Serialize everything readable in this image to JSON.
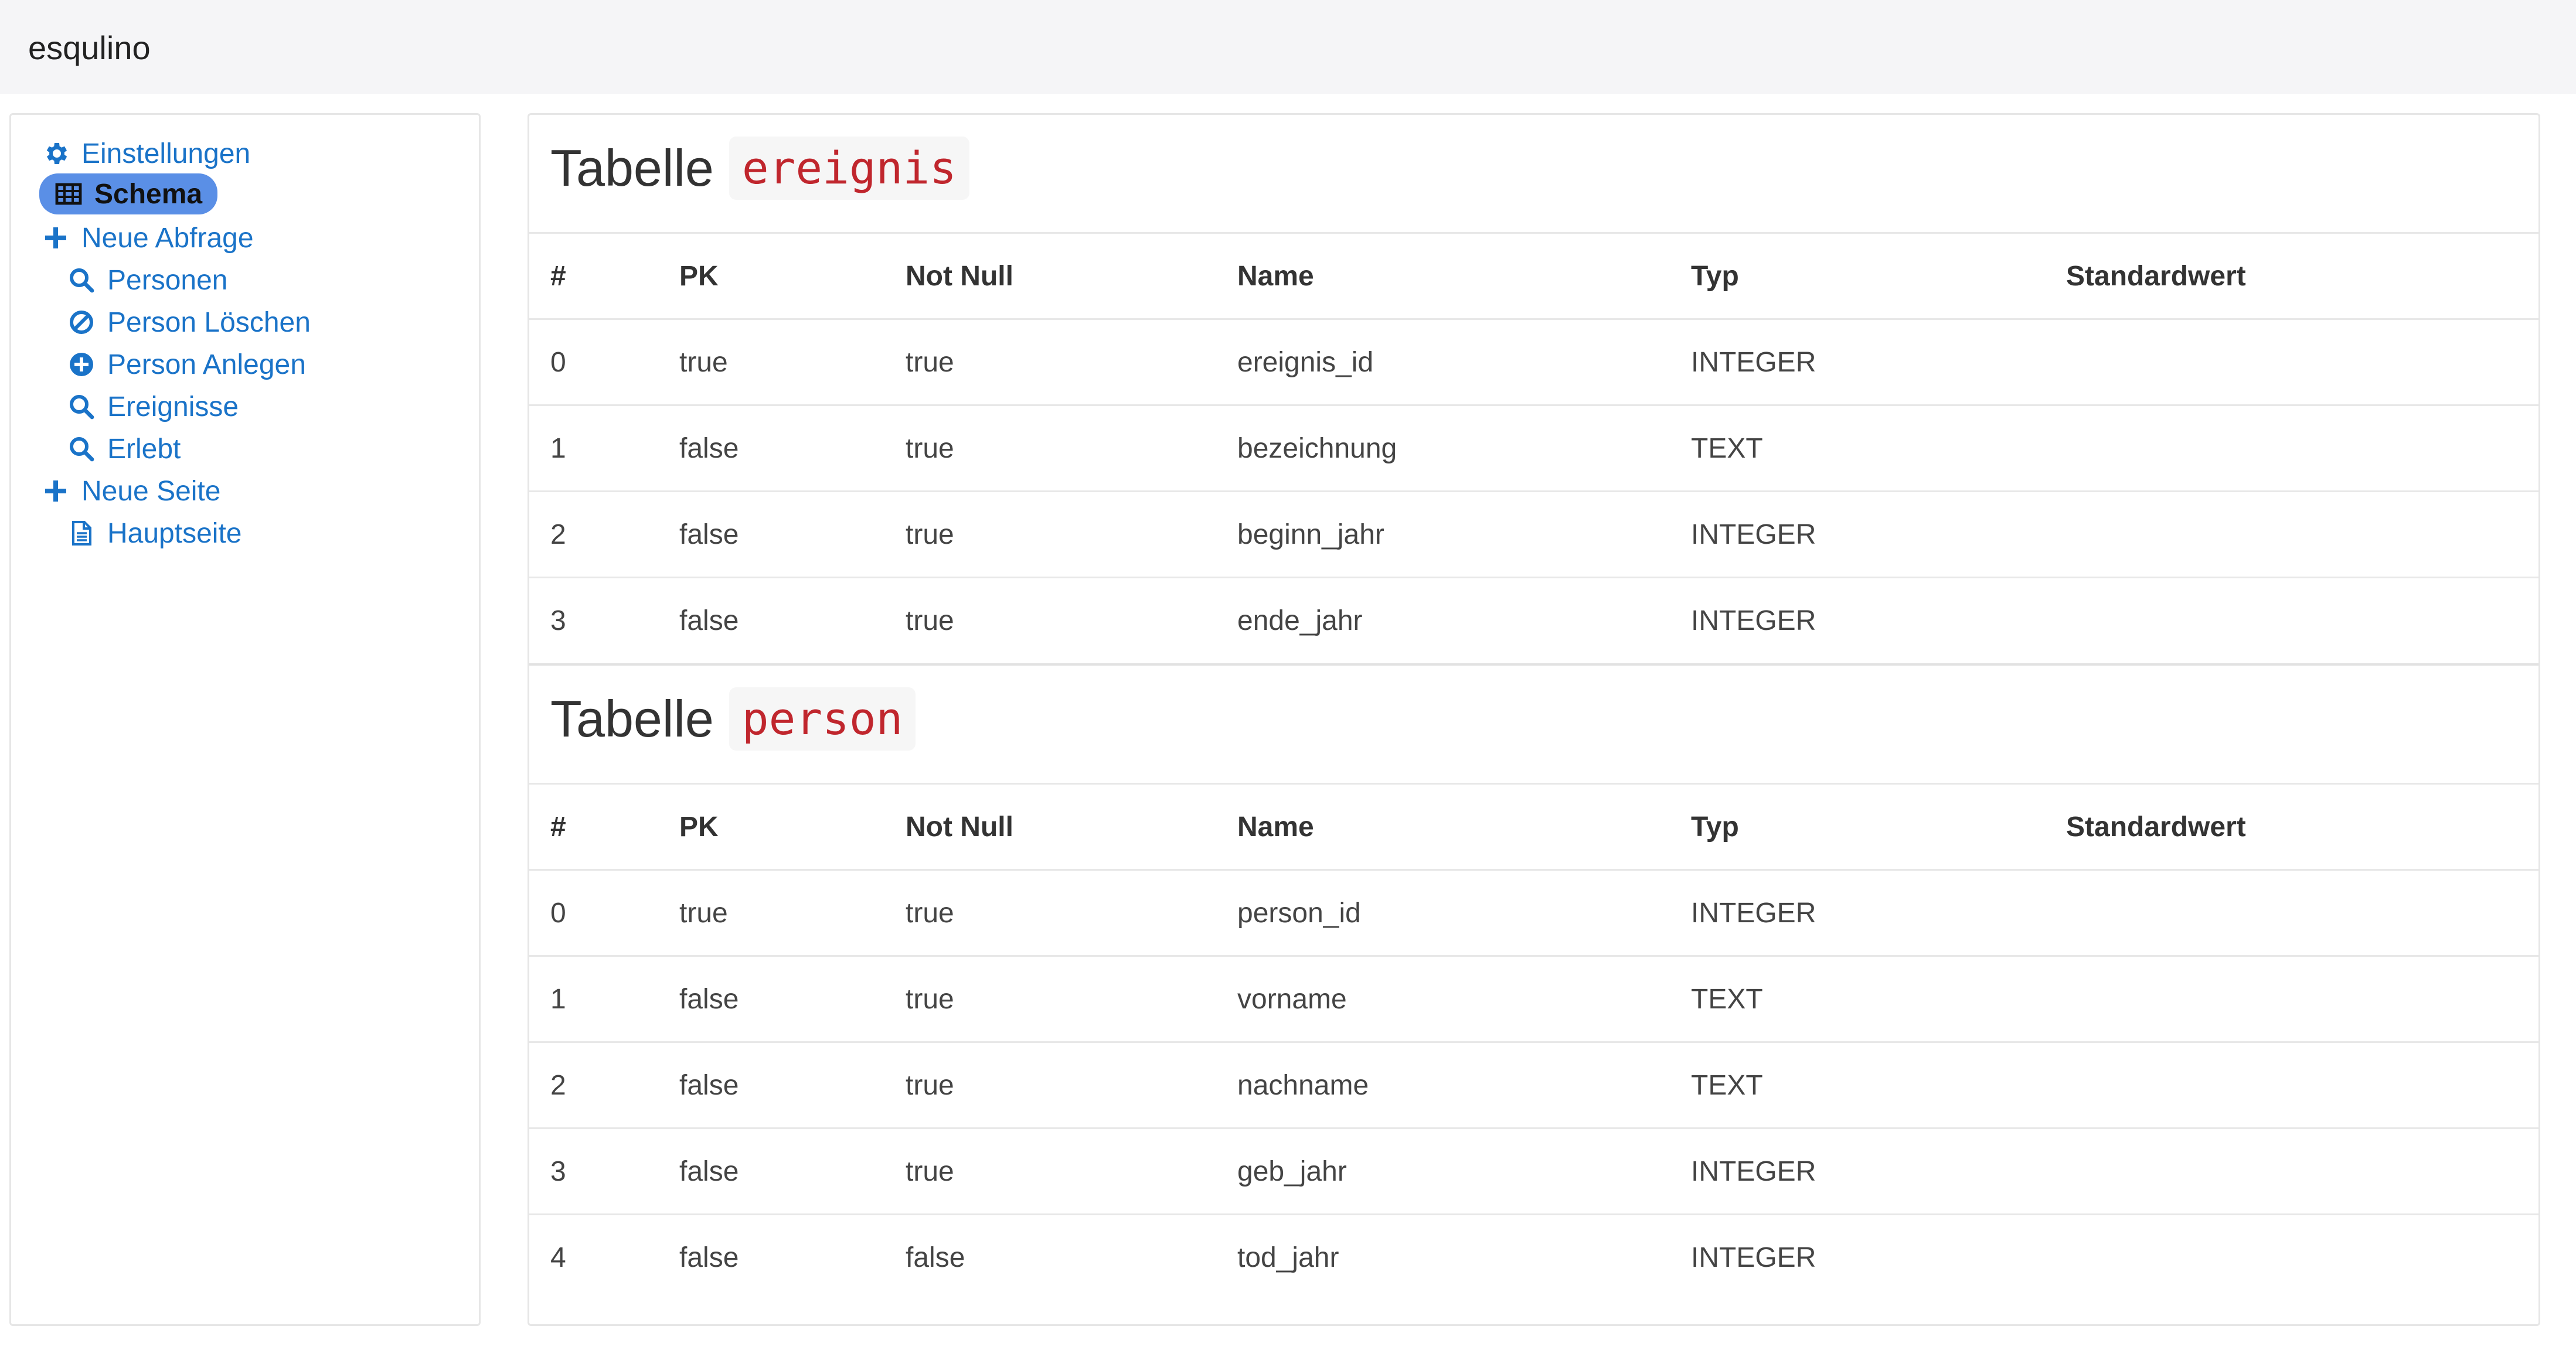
{
  "app": {
    "brand": "esqulino"
  },
  "sidebar": {
    "items": [
      {
        "label": "Einstellungen",
        "icon": "gear-icon"
      },
      {
        "label": "Schema",
        "icon": "table-icon"
      },
      {
        "label": "Neue Abfrage",
        "icon": "plus-icon"
      },
      {
        "label": "Personen",
        "icon": "search-icon"
      },
      {
        "label": "Person Löschen",
        "icon": "ban-icon"
      },
      {
        "label": "Person Anlegen",
        "icon": "plus-circle-icon"
      },
      {
        "label": "Ereignisse",
        "icon": "search-icon"
      },
      {
        "label": "Erlebt",
        "icon": "search-icon"
      },
      {
        "label": "Neue Seite",
        "icon": "plus-icon"
      },
      {
        "label": "Hauptseite",
        "icon": "document-icon"
      }
    ],
    "active_item": "Schema"
  },
  "colors": {
    "link": "#1a73c8",
    "active_pill": "#5a8fe6",
    "code_text": "#c0262d"
  },
  "tables": [
    {
      "title_prefix": "Tabelle",
      "name": "ereignis",
      "headers": [
        "#",
        "PK",
        "Not Null",
        "Name",
        "Typ",
        "Standardwert"
      ],
      "rows": [
        [
          "0",
          "true",
          "true",
          "ereignis_id",
          "INTEGER",
          ""
        ],
        [
          "1",
          "false",
          "true",
          "bezeichnung",
          "TEXT",
          ""
        ],
        [
          "2",
          "false",
          "true",
          "beginn_jahr",
          "INTEGER",
          ""
        ],
        [
          "3",
          "false",
          "true",
          "ende_jahr",
          "INTEGER",
          ""
        ]
      ]
    },
    {
      "title_prefix": "Tabelle",
      "name": "person",
      "headers": [
        "#",
        "PK",
        "Not Null",
        "Name",
        "Typ",
        "Standardwert"
      ],
      "rows": [
        [
          "0",
          "true",
          "true",
          "person_id",
          "INTEGER",
          ""
        ],
        [
          "1",
          "false",
          "true",
          "vorname",
          "TEXT",
          ""
        ],
        [
          "2",
          "false",
          "true",
          "nachname",
          "TEXT",
          ""
        ],
        [
          "3",
          "false",
          "true",
          "geb_jahr",
          "INTEGER",
          ""
        ],
        [
          "4",
          "false",
          "false",
          "tod_jahr",
          "INTEGER",
          ""
        ]
      ]
    }
  ]
}
